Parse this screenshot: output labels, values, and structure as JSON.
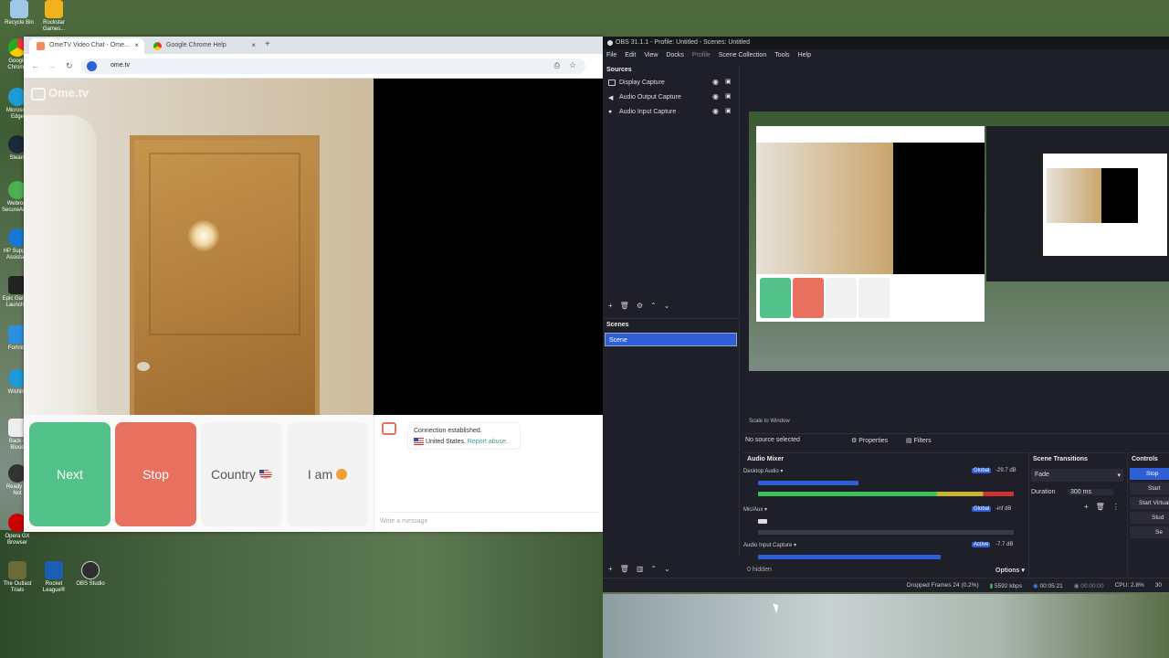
{
  "desktop": {
    "icons_top": [
      "Recycle Bin",
      "Rockstar Games..."
    ],
    "icons_left": [
      "Google Chrome",
      "Microsoft Edge",
      "Steam",
      "Webroot SecureAny...",
      "HP Support Assistant",
      "Epic Games Launcher",
      "Fortnite",
      "Wishlist",
      "Back 4 Blood",
      "Ready or Not",
      "Opera GX Browser"
    ],
    "icons_bottom": [
      "The Outlast Trials",
      "Rocket League®",
      "OBS Studio"
    ]
  },
  "chrome": {
    "tabs": [
      {
        "label": "OmeTV Video Chat - Ome...",
        "active": true
      },
      {
        "label": "Google Chrome Help",
        "active": false
      }
    ],
    "url": "ome.tv"
  },
  "ometv": {
    "logo": "Ome.tv",
    "buttons": {
      "next": "Next",
      "stop": "Stop",
      "country": "Country",
      "iam": "I am"
    },
    "notice_line1": "Connection established.",
    "notice_country": "United States.",
    "notice_report": "Report abuse.",
    "message_placeholder": "Write a message",
    "colors": {
      "next": "#52c28a",
      "stop": "#e8705f"
    }
  },
  "obs": {
    "title": "OBS 31.1.1 - Profile: Untitled - Scenes: Untitled",
    "menu": [
      "File",
      "Edit",
      "View",
      "Docks",
      "Profile",
      "Scene Collection",
      "Tools",
      "Help"
    ],
    "sources_header": "Sources",
    "sources": [
      "Display Capture",
      "Audio Output Capture",
      "Audio Input Capture"
    ],
    "scenes_header": "Scenes",
    "scenes": [
      "Scene"
    ],
    "no_source": "No source selected",
    "properties": "Properties",
    "filters": "Filters",
    "audio_mixer": "Audio Mixer",
    "mixer": [
      {
        "name": "Desktop Audio",
        "tag": "Global",
        "db": "-29.7 dB"
      },
      {
        "name": "Mic/Aux",
        "tag": "Global",
        "db": "-inf dB"
      },
      {
        "name": "Audio Input Capture",
        "tag": "Active",
        "db": "-7.7 dB"
      }
    ],
    "hidden": "0 hidden",
    "options": "Options",
    "scene_transitions": "Scene Transitions",
    "transition": "Fade",
    "duration_label": "Duration",
    "duration_value": "300 ms",
    "controls": "Controls",
    "controls_buttons": [
      "Stop",
      "Start",
      "Start Virtual",
      "Stud",
      "Se"
    ],
    "status": {
      "dropped": "Dropped Frames 24 (0.2%)",
      "kbps": "5592 kbps",
      "rec": "00:05:21",
      "stream": "00:00:00",
      "cpu": "CPU: 2.8%",
      "fps": "30"
    },
    "scale": "Scale to Window"
  }
}
